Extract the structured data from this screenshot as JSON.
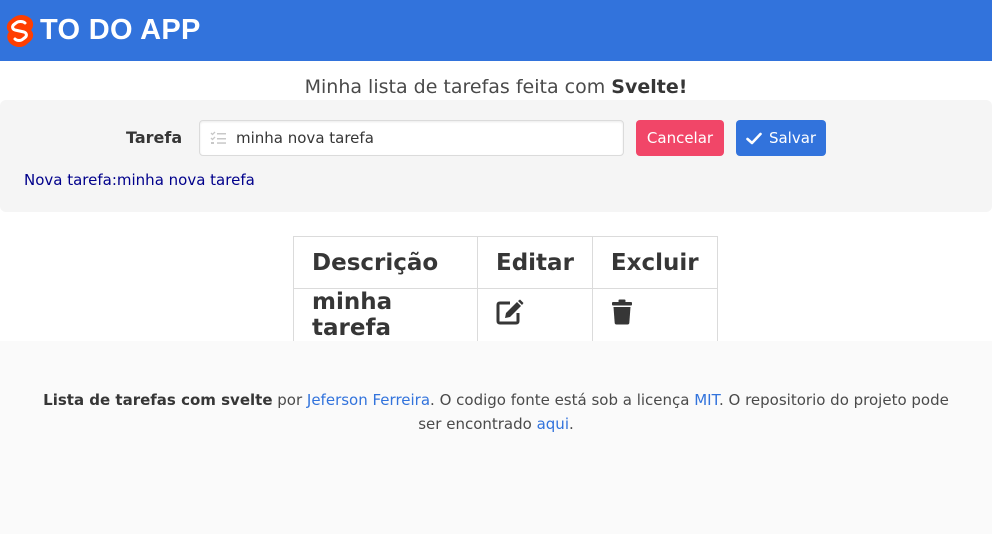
{
  "navbar": {
    "title": "TO DO APP",
    "logo_icon": "svelte-logo-icon",
    "bg_color": "#3273dc",
    "logo_color": "#ff3e00"
  },
  "subtitle": {
    "prefix": "Minha lista de tarefas feita com ",
    "bold": "Svelte!"
  },
  "form": {
    "label": "Tarefa",
    "input_value": "minha nova tarefa",
    "input_icon": "list-check-icon",
    "cancel_label": "Cancelar",
    "save_label": "Salvar",
    "save_icon": "check-icon",
    "cancel_color": "#f14668",
    "save_color": "#3273dc",
    "preview_text": "Nova tarefa:minha nova tarefa"
  },
  "table": {
    "headers": [
      "Descrição",
      "Editar",
      "Excluir"
    ],
    "rows": [
      {
        "description": "minha tarefa",
        "edit_icon": "edit-icon",
        "delete_icon": "trash-icon"
      }
    ]
  },
  "footer": {
    "project_name": "Lista de tarefas com svelte",
    "by": " por ",
    "author": "Jeferson Ferreira",
    "license_text": ". O codigo fonte está sob a licença ",
    "license": "MIT",
    "repo_text": ". O repositorio do projeto pode ser encontrado ",
    "repo_link": "aqui",
    "end": "."
  }
}
